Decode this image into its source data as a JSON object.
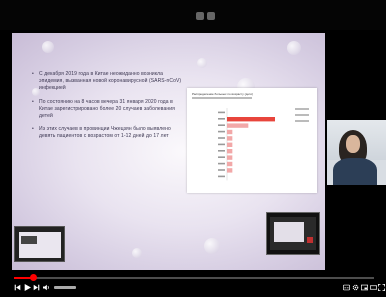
{
  "player": {
    "progress_fraction": 0.055,
    "colors": {
      "progress": "#ff0000",
      "background": "#000000"
    }
  },
  "slide": {
    "bullets": [
      "С декабря 2019 года в Китае неожиданно возникла эпидемия, вызванная новой коронавирусной (SARS-nCoV) инфекцией",
      "По состоянию на 8 часов вечера 31 января 2020 года в Китае зарегистрировано более 20 случаев заболевания детей",
      "Из этих случаев в провинции Чжецзян было выявлено девять пациентов с возрастом от 1-12 дней до 17 лет"
    ],
    "chart_panel": {
      "title": "Распределение больных по возрасту (дети)"
    }
  },
  "chart_data": {
    "type": "bar",
    "categories": [
      "",
      "",
      "",
      "",
      "",
      "",
      "",
      "",
      "",
      "",
      ""
    ],
    "values": [
      0,
      9,
      4,
      1,
      1,
      1,
      1,
      1,
      1,
      1,
      0
    ],
    "highlight_index": 1,
    "colors": {
      "bar": "#f2a8a8",
      "highlight": "#e8453c"
    }
  },
  "icons": {
    "top": [
      "view-grid-icon",
      "view-toggle-icon"
    ],
    "controls_left": [
      "previous-icon",
      "play-icon",
      "next-icon",
      "volume-icon"
    ],
    "controls_right": [
      "subtitles-icon",
      "settings-icon",
      "miniplayer-icon",
      "theater-icon",
      "fullscreen-icon"
    ]
  }
}
